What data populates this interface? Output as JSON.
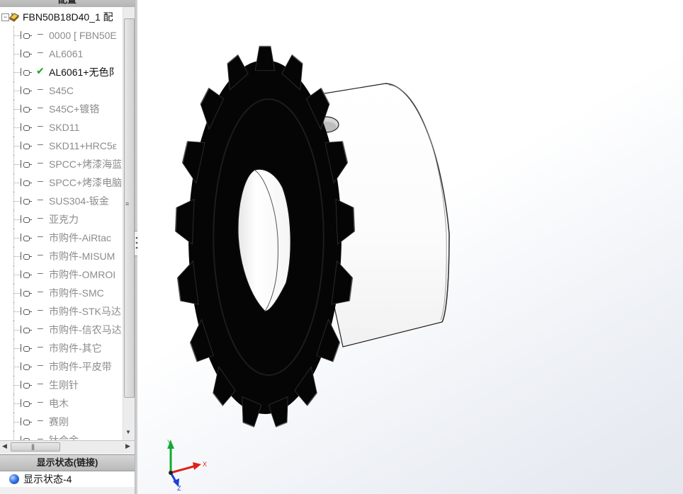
{
  "panel": {
    "header_title": "配置",
    "root_label": "FBN50B18D40_1 配",
    "configurations": [
      {
        "label": "0000 [ FBN50E",
        "state": "dash",
        "active": false
      },
      {
        "label": "AL6061",
        "state": "dash",
        "active": false
      },
      {
        "label": "AL6061+无色阝",
        "state": "check",
        "active": true
      },
      {
        "label": "S45C",
        "state": "dash",
        "active": false
      },
      {
        "label": "S45C+镀铬",
        "state": "dash",
        "active": false
      },
      {
        "label": "SKD11",
        "state": "dash",
        "active": false
      },
      {
        "label": "SKD11+HRC5ε",
        "state": "dash",
        "active": false
      },
      {
        "label": "SPCC+烤漆海蓝",
        "state": "dash",
        "active": false
      },
      {
        "label": "SPCC+烤漆电脑",
        "state": "dash",
        "active": false
      },
      {
        "label": "SUS304-钣金",
        "state": "dash",
        "active": false
      },
      {
        "label": "亚克力",
        "state": "dash",
        "active": false
      },
      {
        "label": "市购件-AiRtac",
        "state": "dash",
        "active": false
      },
      {
        "label": "市购件-MISUM",
        "state": "dash",
        "active": false
      },
      {
        "label": "市购件-OMROI",
        "state": "dash",
        "active": false
      },
      {
        "label": "市购件-SMC",
        "state": "dash",
        "active": false
      },
      {
        "label": "市购件-STK马达",
        "state": "dash",
        "active": false
      },
      {
        "label": "市购件-信农马达",
        "state": "dash",
        "active": false
      },
      {
        "label": "市购件-其它",
        "state": "dash",
        "active": false
      },
      {
        "label": "市购件-平皮带",
        "state": "dash",
        "active": false
      },
      {
        "label": "生刚针",
        "state": "dash",
        "active": false
      },
      {
        "label": "电木",
        "state": "dash",
        "active": false
      },
      {
        "label": "赛刚",
        "state": "dash",
        "active": false
      },
      {
        "label": "钛合金",
        "state": "dash",
        "active": false
      }
    ]
  },
  "display_states": {
    "header": "显示状态(链接)",
    "items": [
      {
        "label": "显示状态-4"
      }
    ]
  },
  "triad": {
    "x_label": "X",
    "y_label": "Y",
    "z_label": "Z"
  },
  "colors": {
    "sprocket": "#050505",
    "hub": "#ffffff",
    "axis_x": "#e0201a",
    "axis_y": "#14a838",
    "axis_z": "#1f3fd6"
  }
}
